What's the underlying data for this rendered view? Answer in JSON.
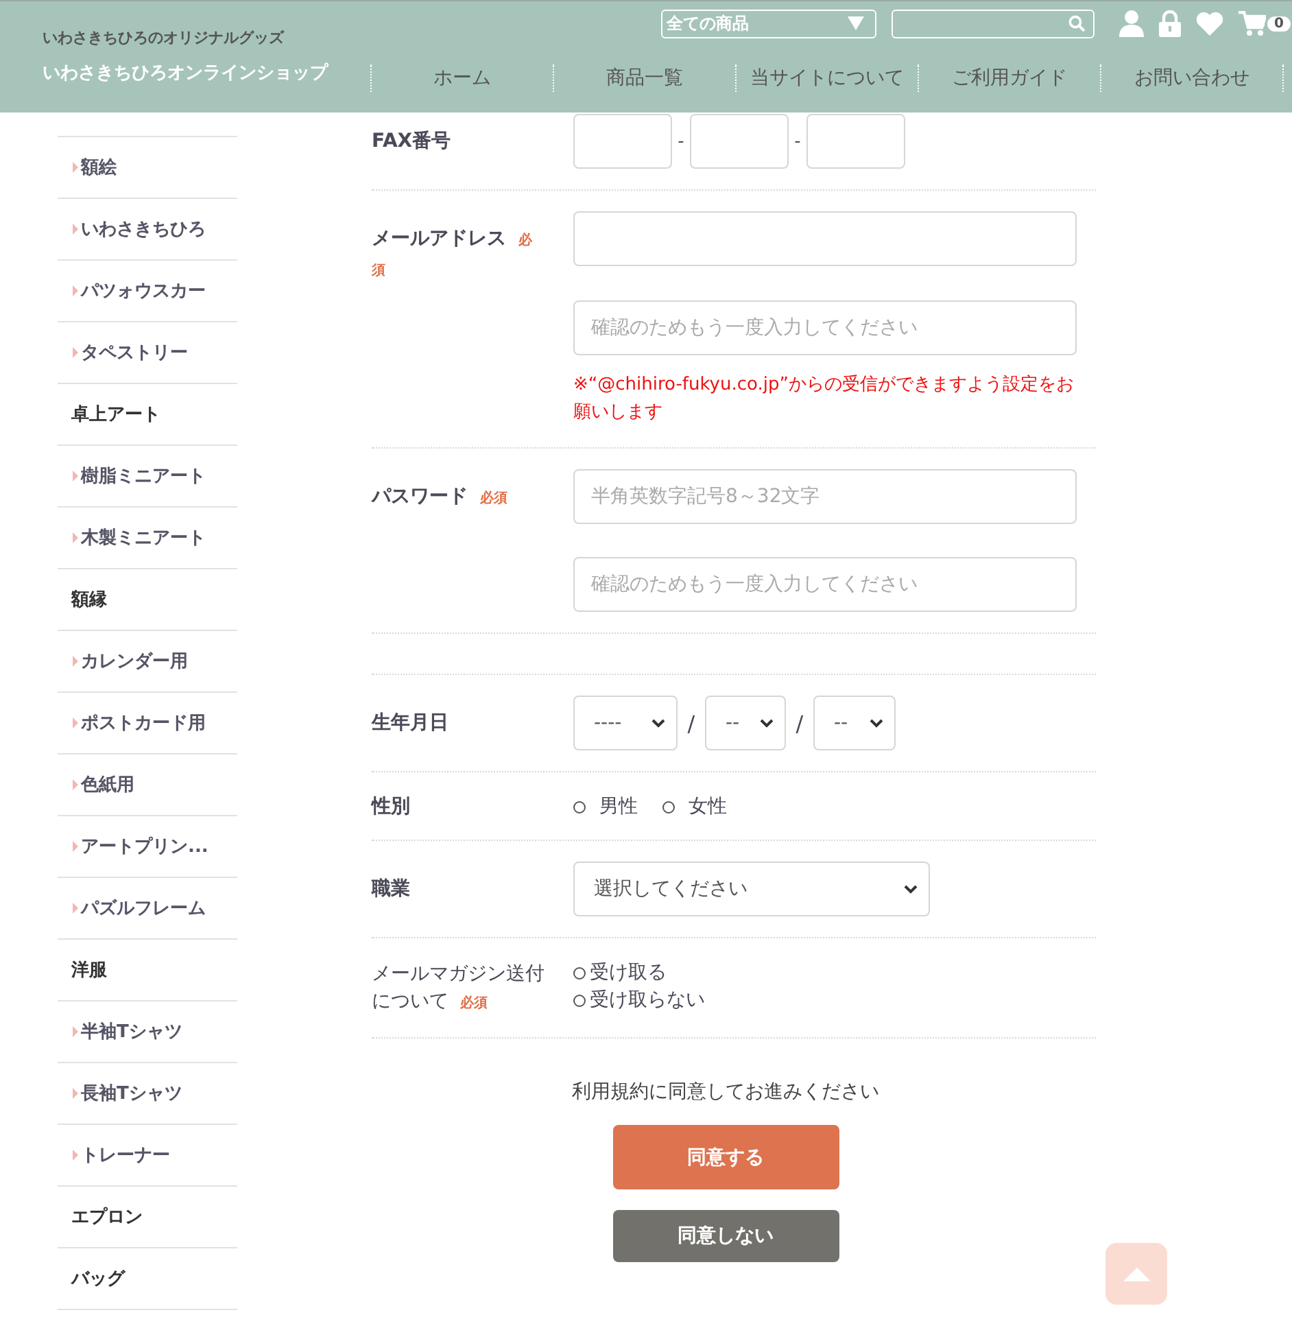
{
  "header": {
    "tagline": "いわさきちひろのオリジナルグッズ",
    "shop_name": "いわさきちひろオンラインショップ",
    "category_select": "全ての商品",
    "cart_count": "0",
    "nav": [
      {
        "label": "ホーム"
      },
      {
        "label": "商品一覧"
      },
      {
        "label": "当サイトについて"
      },
      {
        "label": "ご利用ガイド"
      },
      {
        "label": "お問い合わせ"
      }
    ]
  },
  "sidebar": {
    "items": [
      {
        "kind": "sub",
        "label": "額絵"
      },
      {
        "kind": "sub",
        "label": "いわさきちひろ"
      },
      {
        "kind": "sub",
        "label": "パツォウスカー"
      },
      {
        "kind": "sub",
        "label": "タペストリー"
      },
      {
        "kind": "category",
        "label": "卓上アート"
      },
      {
        "kind": "sub",
        "label": "樹脂ミニアート"
      },
      {
        "kind": "sub",
        "label": "木製ミニアート"
      },
      {
        "kind": "category",
        "label": "額縁"
      },
      {
        "kind": "sub",
        "label": "カレンダー用"
      },
      {
        "kind": "sub",
        "label": "ポストカード用"
      },
      {
        "kind": "sub",
        "label": "色紙用"
      },
      {
        "kind": "sub",
        "label": "アートプリン..."
      },
      {
        "kind": "sub",
        "label": "パズルフレーム"
      },
      {
        "kind": "category",
        "label": "洋服"
      },
      {
        "kind": "sub",
        "label": "半袖Tシャツ"
      },
      {
        "kind": "sub",
        "label": "長袖Tシャツ"
      },
      {
        "kind": "sub",
        "label": "トレーナー"
      },
      {
        "kind": "category",
        "label": "エプロン"
      },
      {
        "kind": "category",
        "label": "バッグ"
      }
    ]
  },
  "form": {
    "rows": [
      {
        "kind": "tel",
        "label": "FAX番号",
        "separators": [
          "-",
          "-"
        ]
      },
      {
        "kind": "email",
        "label": "メールアドレス",
        "badge": "必須",
        "confirm_placeholder": "確認のためもう一度入力してください",
        "note": "※“@chihiro-fukyu.co.jp”からの受信ができますよう設定をお願いします"
      },
      {
        "kind": "password",
        "label": "パスワード",
        "badge": "必須",
        "placeholder": "半角英数字記号8～32文字",
        "confirm_placeholder": "確認のためもう一度入力してください"
      },
      {
        "kind": "spacer"
      },
      {
        "kind": "date",
        "label": "生年月日",
        "selects": [
          {
            "value": "----"
          },
          {
            "value": "--"
          },
          {
            "value": "--"
          }
        ],
        "separators": [
          "/",
          "/"
        ]
      },
      {
        "kind": "radio_inline",
        "label": "性別",
        "options": [
          {
            "label": "男性",
            "selected": false
          },
          {
            "label": "女性",
            "selected": false
          }
        ]
      },
      {
        "kind": "select",
        "label": "職業",
        "value": "選択してください"
      },
      {
        "kind": "radio_list",
        "label": "メールマガジン送付について",
        "badge": "必須",
        "options": [
          {
            "label": "受け取る",
            "selected": false
          },
          {
            "label": "受け取らない",
            "selected": false
          }
        ]
      }
    ]
  },
  "terms": {
    "text": "利用規約に同意してお進みください",
    "agree": "同意する",
    "disagree": "同意しない"
  }
}
